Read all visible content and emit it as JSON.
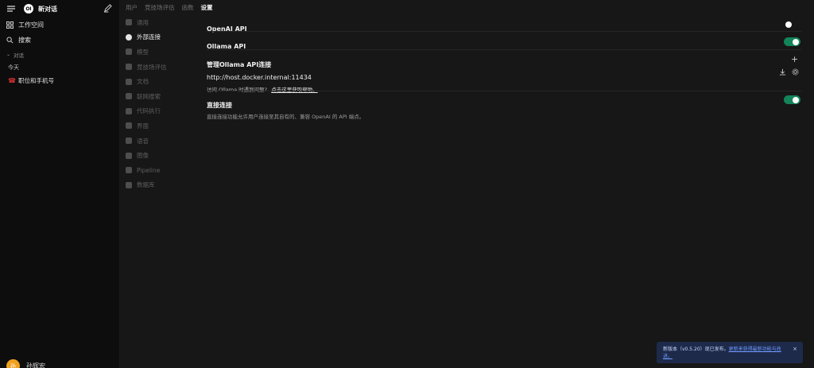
{
  "sidebar": {
    "logo_text": "OI",
    "new_chat": "新对话",
    "workspace": "工作空间",
    "search": "搜索",
    "section": "对话",
    "day": "今天",
    "chats": [
      {
        "title": "职位和手机号"
      }
    ],
    "user": {
      "avatar": "孙",
      "name": "孙辉宏"
    }
  },
  "top_tabs": [
    "用户",
    "竞技场评估",
    "函数",
    "设置"
  ],
  "settings_nav": [
    "通用",
    "外部连接",
    "模型",
    "竞技场评估",
    "文档",
    "联网搜索",
    "代码执行",
    "界面",
    "语音",
    "图像",
    "Pipeline",
    "数据库"
  ],
  "settings_nav_active": "外部连接",
  "connections": {
    "openai_api": {
      "label": "OpenAI API",
      "enabled": false
    },
    "ollama_api": {
      "label": "Ollama API",
      "enabled": true
    },
    "manage_ollama": {
      "label": "管理Ollama API连接",
      "url": "http://host.docker.internal:11434"
    },
    "help_text": "访问 Ollama 时遇到问题?",
    "help_link": "点击这里获取帮助。",
    "direct": {
      "label": "直接连接",
      "enabled": true,
      "description": "直接连接功能允许用户连接至其自有的、兼容 OpenAI 的 API 端点。"
    }
  },
  "toast": {
    "text": "新版本（v0.5.20）现已发布。",
    "link": "更新来获得最新功能与改进。",
    "close": "×"
  },
  "colors": {
    "accent": "#14845a",
    "toast_bg": "#1e2a4a",
    "toast_link": "#6f9bff"
  }
}
